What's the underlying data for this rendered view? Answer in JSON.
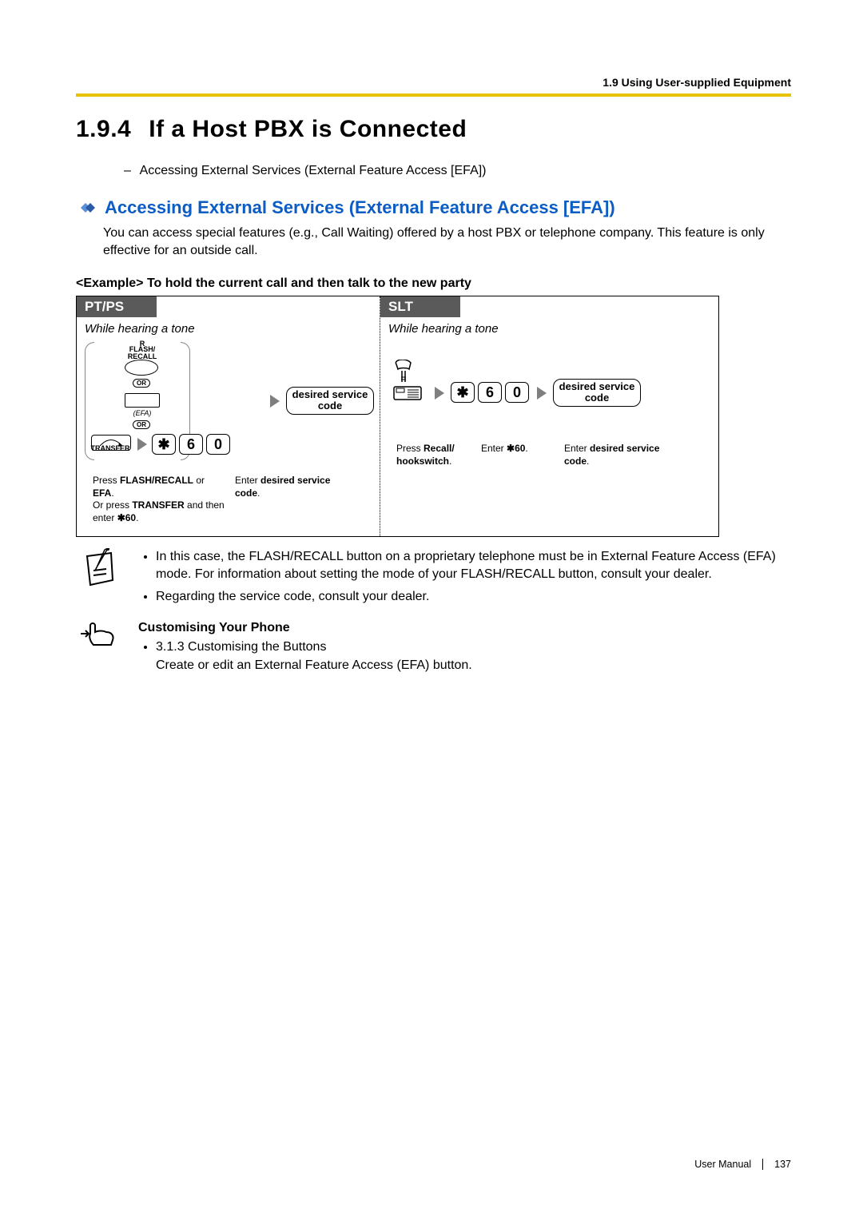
{
  "header": {
    "label": "1.9 Using User-supplied Equipment"
  },
  "section": {
    "number": "1.9.4",
    "title": "If a Host PBX is Connected"
  },
  "intro_link": "Accessing External Services (External Feature Access [EFA])",
  "subheading": "Accessing External Services (External Feature Access [EFA])",
  "body": "You can access special features (e.g., Call Waiting) offered by a host PBX or telephone company. This feature is only effective for an outside call.",
  "example_label": "<Example> To hold the current call and then talk to the new party",
  "diagram": {
    "pt": {
      "tab": "PT/PS",
      "condition": "While hearing a tone",
      "flash_top": "R",
      "flash_label": "FLASH/\nRECALL",
      "or": "OR",
      "efa": "(EFA)",
      "transfer": "TRANSFER",
      "key_star": "✱",
      "key_6": "6",
      "key_0": "0",
      "service": "desired service\ncode",
      "caption1a": "Press ",
      "caption1b": "FLASH/RECALL",
      "caption1c": " or ",
      "caption1d": "EFA",
      "caption1e": ".\nOr press ",
      "caption1f": "TRANSFER",
      "caption1g": " and then enter ",
      "caption1h": "✱60",
      "caption1i": ".",
      "caption2a": "Enter ",
      "caption2b": "desired service code",
      "caption2c": "."
    },
    "slt": {
      "tab": "SLT",
      "condition": "While hearing a tone",
      "key_star": "✱",
      "key_6": "6",
      "key_0": "0",
      "service": "desired service\ncode",
      "caption1a": "Press ",
      "caption1b": "Recall/ hookswitch",
      "caption1c": ".",
      "caption2a": "Enter ",
      "caption2b": "✱60",
      "caption2c": ".",
      "caption3a": "Enter ",
      "caption3b": "desired service code",
      "caption3c": "."
    }
  },
  "notes": {
    "n1": "In this case, the FLASH/RECALL button on a proprietary telephone must be in External Feature Access (EFA) mode. For information about setting the mode of your FLASH/RECALL button, consult your dealer.",
    "n2": "Regarding the service code, consult your dealer."
  },
  "customising": {
    "title": "Customising Your Phone",
    "link": "3.1.3 Customising the Buttons",
    "text": "Create or edit an External Feature Access (EFA) button."
  },
  "footer": {
    "doc": "User Manual",
    "page": "137"
  }
}
